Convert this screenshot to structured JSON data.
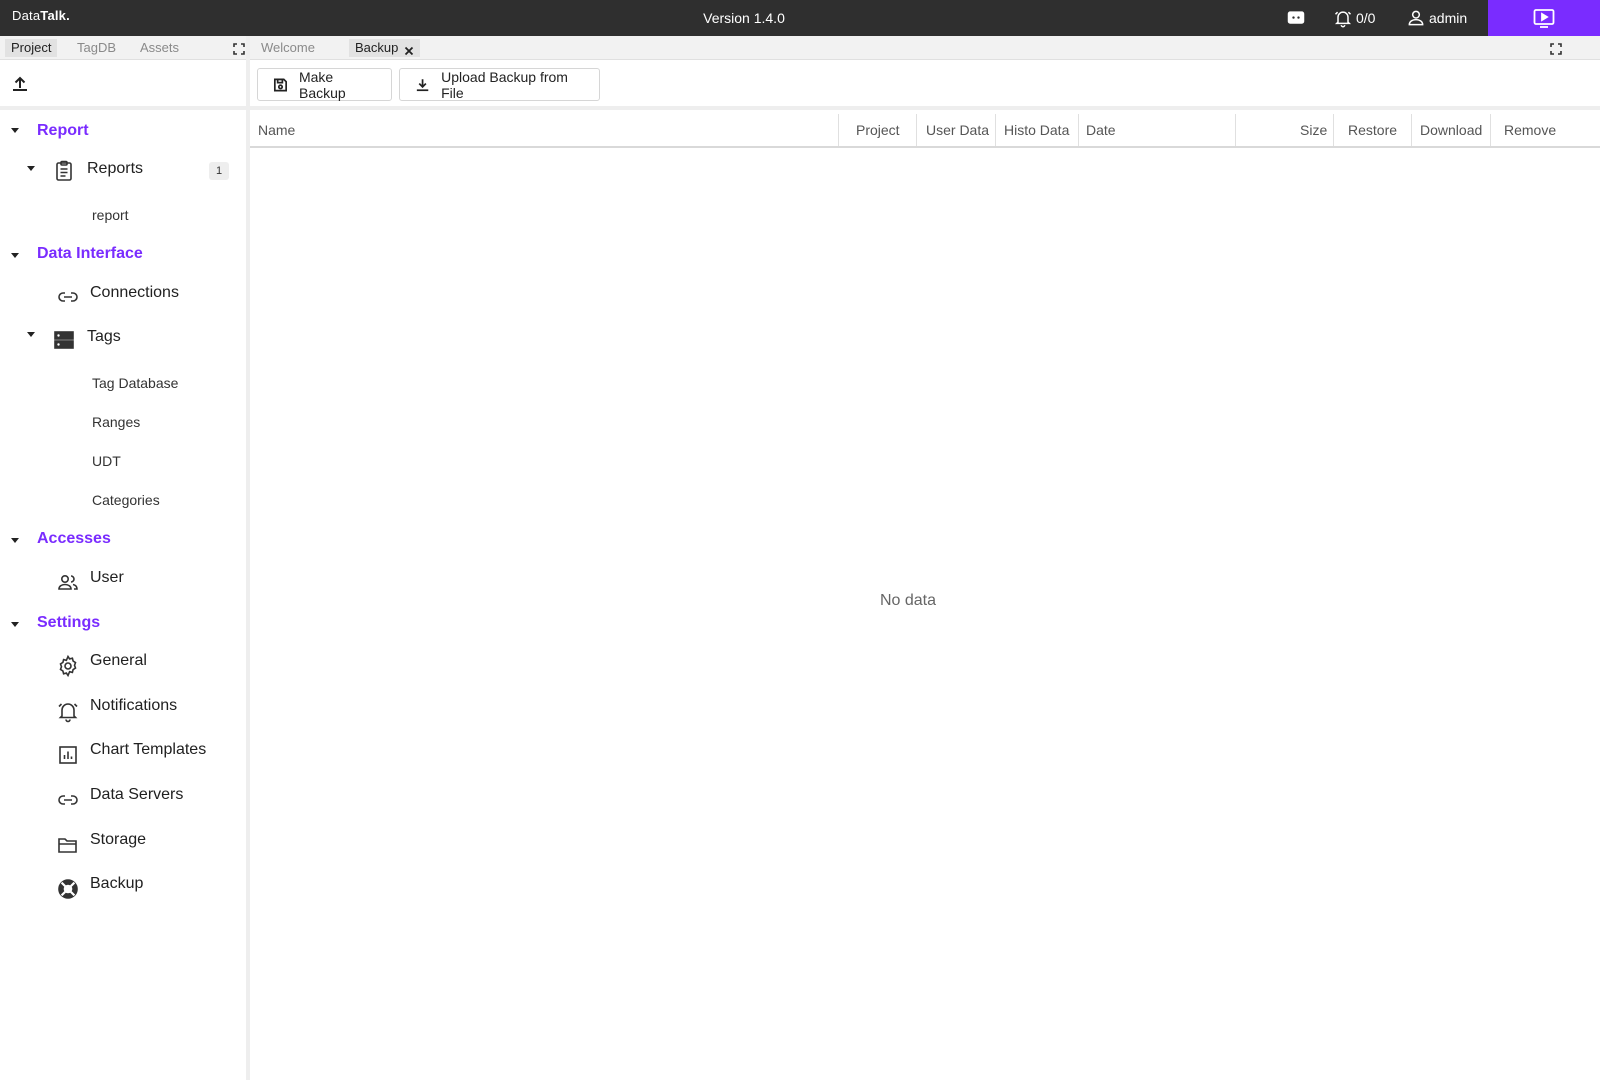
{
  "app": {
    "brand_prefix": "Data",
    "brand_bold": "Talk.",
    "version": "Version 1.4.0",
    "alarms_count": "0/0",
    "user_name": "admin",
    "accent_color": "#7a2cff"
  },
  "sidebar": {
    "tabs": [
      "Project",
      "TagDB",
      "Assets"
    ],
    "active_tab": "Project",
    "sections": {
      "report": {
        "label": "Report",
        "reports_label": "Reports",
        "reports_badge": "1",
        "report_leaf": "report"
      },
      "data_interface": {
        "label": "Data Interface",
        "connections_label": "Connections",
        "tags_label": "Tags",
        "tag_leaves": [
          "Tag Database",
          "Ranges",
          "UDT",
          "Categories"
        ]
      },
      "accesses": {
        "label": "Accesses",
        "user_label": "User"
      },
      "settings": {
        "label": "Settings",
        "items": [
          "General",
          "Notifications",
          "Chart Templates",
          "Data Servers",
          "Storage",
          "Backup"
        ]
      }
    },
    "icons": {
      "upload": "upload-icon",
      "reports": "clipboard-icon",
      "connections": "link-icon",
      "tags": "storage-icon",
      "user": "people-icon",
      "general": "gear-icon",
      "notifications": "alarm-bell-icon",
      "chart_templates": "chart-icon",
      "data_servers": "link-icon",
      "storage": "folder-icon",
      "backup": "lifebuoy-icon"
    }
  },
  "main": {
    "tabs": [
      "Welcome",
      "Backup"
    ],
    "active_tab": "Backup",
    "toolbar": {
      "make_backup_label": "Make Backup",
      "upload_label": "Upload Backup from File"
    },
    "table": {
      "columns": [
        "Name",
        "Project",
        "User Data",
        "Histo Data",
        "Date",
        "Size",
        "Restore",
        "Download",
        "Remove"
      ],
      "rows": [],
      "empty_text": "No data"
    }
  }
}
